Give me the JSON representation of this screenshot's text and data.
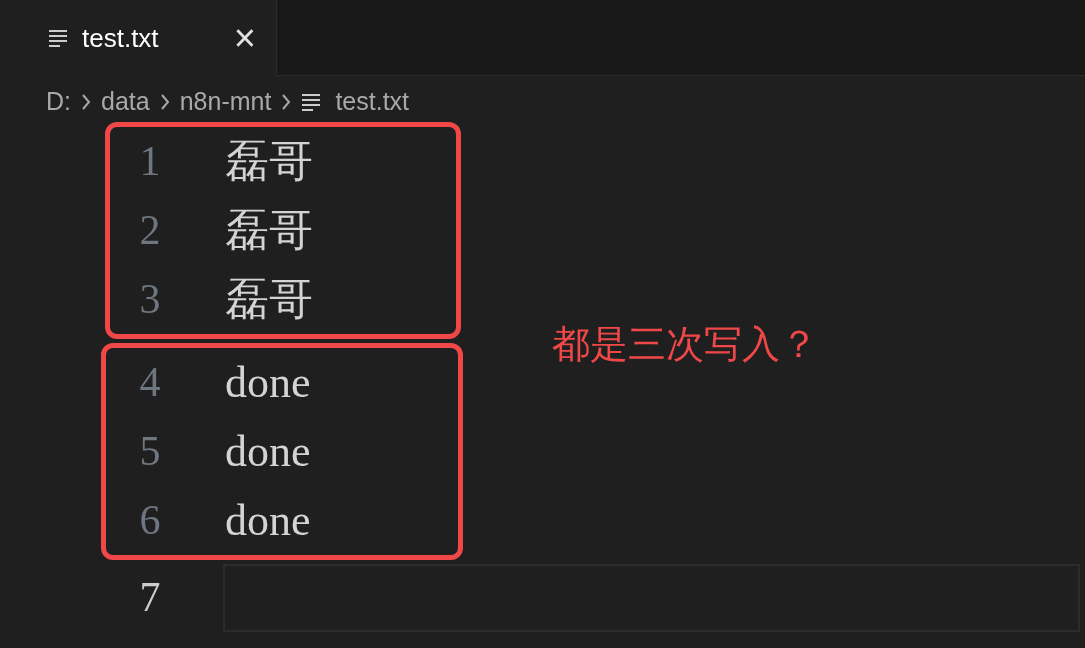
{
  "tabs": [
    {
      "label": "test.txt",
      "selected": true,
      "close": "×"
    }
  ],
  "breadcrumb": [
    {
      "kind": "folder",
      "label": "D:"
    },
    {
      "kind": "folder",
      "label": "data"
    },
    {
      "kind": "folder",
      "label": "n8n-mnt"
    },
    {
      "kind": "file",
      "label": "test.txt"
    }
  ],
  "editor": {
    "groups": [
      {
        "boxed": true,
        "lines": [
          {
            "number": "1",
            "text": "磊哥",
            "current": false
          },
          {
            "number": "2",
            "text": "磊哥",
            "current": false
          },
          {
            "number": "3",
            "text": "磊哥",
            "current": false
          }
        ]
      },
      {
        "boxed": true,
        "lines": [
          {
            "number": "4",
            "text": "done",
            "current": false
          },
          {
            "number": "5",
            "text": "done",
            "current": false
          },
          {
            "number": "6",
            "text": "done",
            "current": false
          }
        ]
      },
      {
        "boxed": false,
        "lines": [
          {
            "number": "7",
            "current": true
          }
        ]
      }
    ]
  },
  "annotation_note": "都是三次写入？"
}
